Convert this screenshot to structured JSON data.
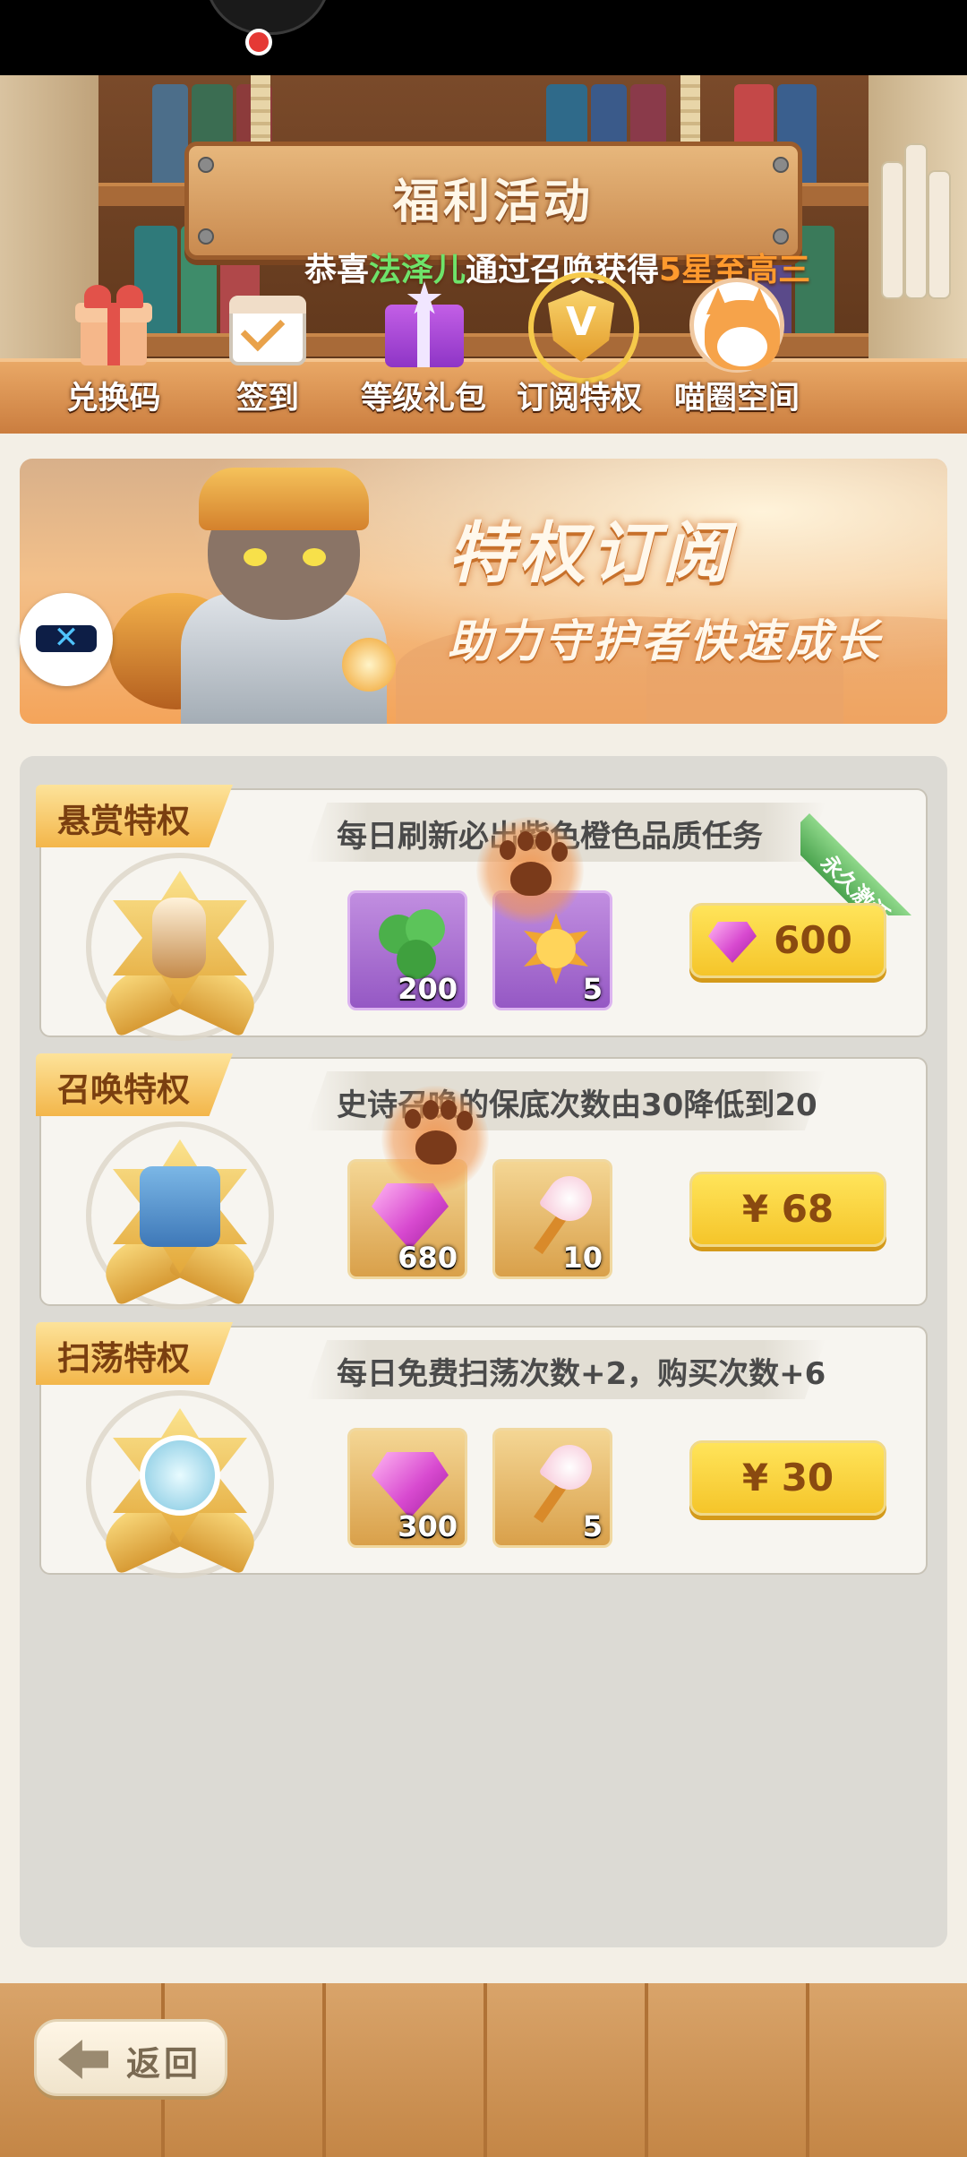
{
  "header": {
    "title": "福利活动",
    "marquee": {
      "prefix": "恭喜",
      "name": "法泽儿",
      "middle": "通过召唤获得",
      "highlight": "5星至高三"
    }
  },
  "tabs": [
    {
      "label": "兑换码",
      "icon": "gift-icon"
    },
    {
      "label": "签到",
      "icon": "calendar-check-icon"
    },
    {
      "label": "等级礼包",
      "icon": "purple-gift-icon"
    },
    {
      "label": "订阅特权",
      "icon": "vip-shield-icon",
      "selected": true
    },
    {
      "label": "喵圈空间",
      "icon": "cat-face-icon"
    }
  ],
  "banner": {
    "title": "特权订阅",
    "subtitle": "助力守护者快速成长"
  },
  "privileges": [
    {
      "tag": "悬赏特权",
      "description": "每日刷新必出紫色橙色品质任务",
      "badge": "永久激活",
      "rewards": [
        {
          "icon": "clover-leaves-icon",
          "qty": "200"
        },
        {
          "icon": "sun-face-icon",
          "qty": "5"
        }
      ],
      "price": "600",
      "price_icon": "gem-icon"
    },
    {
      "tag": "召唤特权",
      "description": "史诗召唤的保底次数由30降低到20",
      "rewards": [
        {
          "icon": "pink-gem-icon",
          "qty": "680"
        },
        {
          "icon": "summon-wand-icon",
          "qty": "10"
        }
      ],
      "price": "¥ 68"
    },
    {
      "tag": "扫荡特权",
      "description": "每日免费扫荡次数+2，购买次数+6",
      "rewards": [
        {
          "icon": "pink-gem-icon",
          "qty": "300"
        },
        {
          "icon": "summon-wand-icon",
          "qty": "5"
        }
      ],
      "price": "¥ 30"
    }
  ],
  "footer": {
    "back_label": "返回"
  },
  "colors": {
    "accent_yellow": "#f5c52a",
    "tag_gold": "#f3b64a",
    "ribbon_green": "#4aa34e",
    "panel_bg": "#dcdad4"
  }
}
